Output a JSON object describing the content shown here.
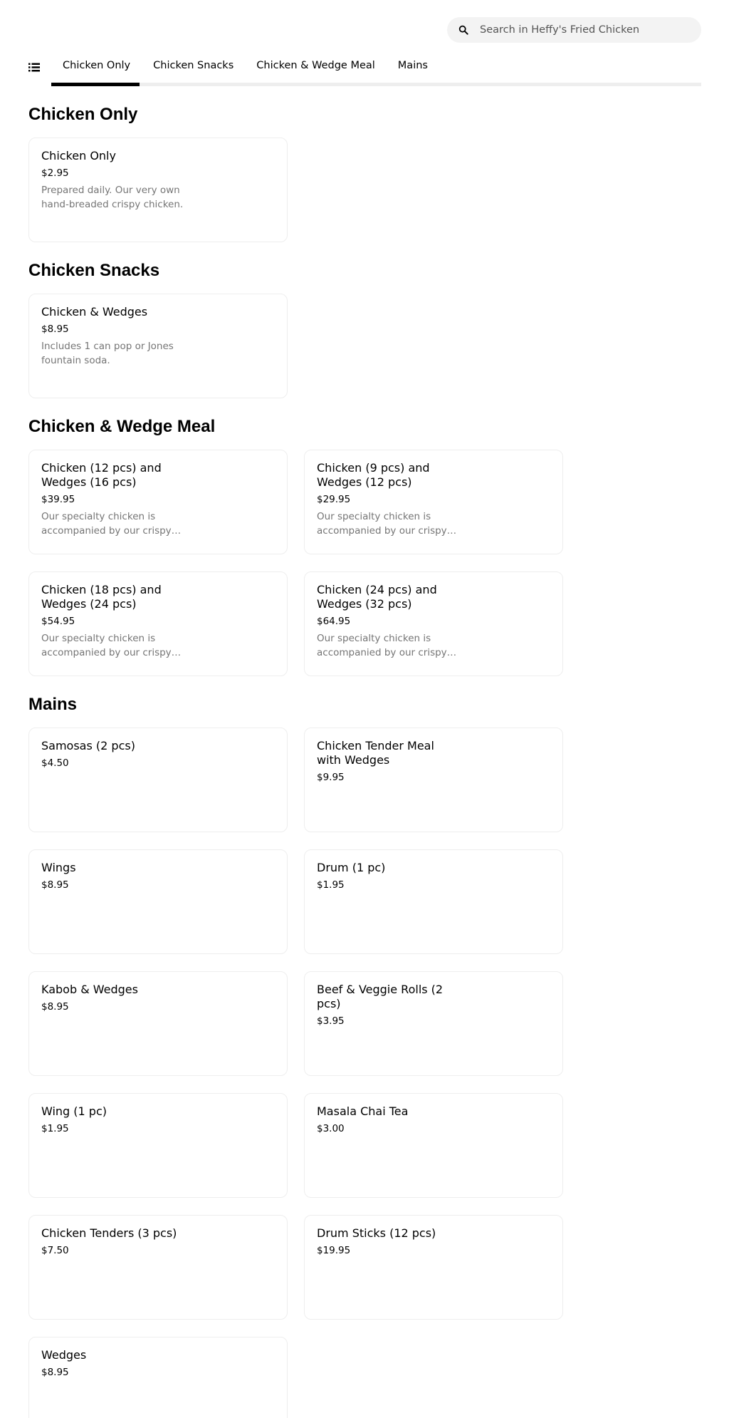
{
  "search": {
    "placeholder": "Search in Heffy's Fried Chicken"
  },
  "tabs": [
    {
      "label": "Chicken Only",
      "active": true
    },
    {
      "label": "Chicken Snacks",
      "active": false
    },
    {
      "label": "Chicken & Wedge Meal",
      "active": false
    },
    {
      "label": "Mains",
      "active": false
    }
  ],
  "sections": [
    {
      "title": "Chicken Only",
      "items": [
        {
          "name": "Chicken Only",
          "price": "$2.95",
          "description": "Prepared daily. Our very own hand-breaded crispy chicken."
        }
      ]
    },
    {
      "title": "Chicken Snacks",
      "items": [
        {
          "name": "Chicken & Wedges",
          "price": "$8.95",
          "description": "Includes 1 can pop or Jones fountain soda."
        }
      ]
    },
    {
      "title": "Chicken & Wedge Meal",
      "items": [
        {
          "name": "Chicken (12 pcs) and Wedges (16 pcs)",
          "price": "$39.95",
          "description": "Our specialty chicken is accompanied by our crispy wedges."
        },
        {
          "name": "Chicken (9 pcs) and Wedges (12 pcs)",
          "price": "$29.95",
          "description": "Our specialty chicken is accompanied by our crispy wedges."
        },
        {
          "name": "Chicken (18 pcs) and Wedges (24 pcs)",
          "price": "$54.95",
          "description": "Our specialty chicken is accompanied by our crispy wedges."
        },
        {
          "name": "Chicken (24 pcs) and Wedges (32 pcs)",
          "price": "$64.95",
          "description": "Our specialty chicken is accompanied by our crispy wedges."
        }
      ]
    },
    {
      "title": "Mains",
      "items": [
        {
          "name": "Samosas (2 pcs)",
          "price": "$4.50"
        },
        {
          "name": "Chicken Tender Meal with Wedges",
          "price": "$9.95"
        },
        {
          "name": "Wings",
          "price": "$8.95"
        },
        {
          "name": "Drum (1 pc)",
          "price": "$1.95"
        },
        {
          "name": "Kabob & Wedges",
          "price": "$8.95"
        },
        {
          "name": "Beef & Veggie Rolls (2 pcs)",
          "price": "$3.95"
        },
        {
          "name": "Wing (1 pc)",
          "price": "$1.95"
        },
        {
          "name": "Masala Chai Tea",
          "price": "$3.00"
        },
        {
          "name": "Chicken Tenders (3 pcs)",
          "price": "$7.50"
        },
        {
          "name": "Drum Sticks (12 pcs)",
          "price": "$19.95"
        },
        {
          "name": "Wedges",
          "price": "$8.95"
        }
      ]
    }
  ]
}
